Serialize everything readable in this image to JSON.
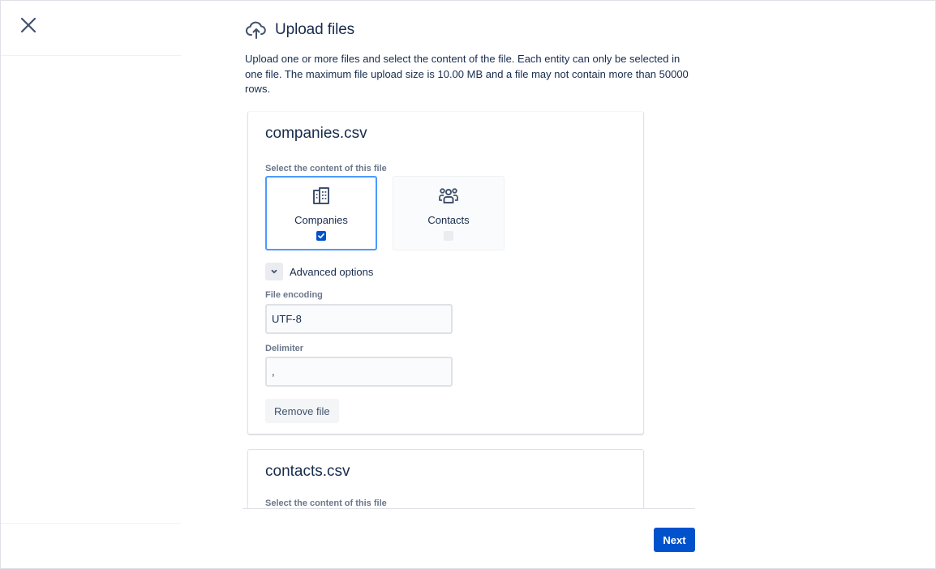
{
  "header": {
    "title": "Upload files",
    "icon": "cloud-upload-icon"
  },
  "intro": "Upload one or more files and select the content of the file. Each entity can only be selected in one file. The maximum file upload size is 10.00 MB and a file may not contain more than 50000 rows.",
  "files": [
    {
      "name": "companies.csv",
      "select_label": "Select the content of this file",
      "options": [
        {
          "label": "Companies",
          "icon": "building-icon",
          "checked": true
        },
        {
          "label": "Contacts",
          "icon": "people-group-icon",
          "checked": false
        }
      ],
      "advanced_label": "Advanced options",
      "encoding_label": "File encoding",
      "encoding_value": "UTF-8",
      "delimiter_label": "Delimiter",
      "delimiter_value": ",",
      "remove_label": "Remove file"
    },
    {
      "name": "contacts.csv",
      "select_label": "Select the content of this file"
    }
  ],
  "footer": {
    "next_label": "Next"
  },
  "colors": {
    "primary": "#0052cc",
    "selected_border": "#4c9aff",
    "text": "#172b4d",
    "muted": "#6b778c"
  }
}
